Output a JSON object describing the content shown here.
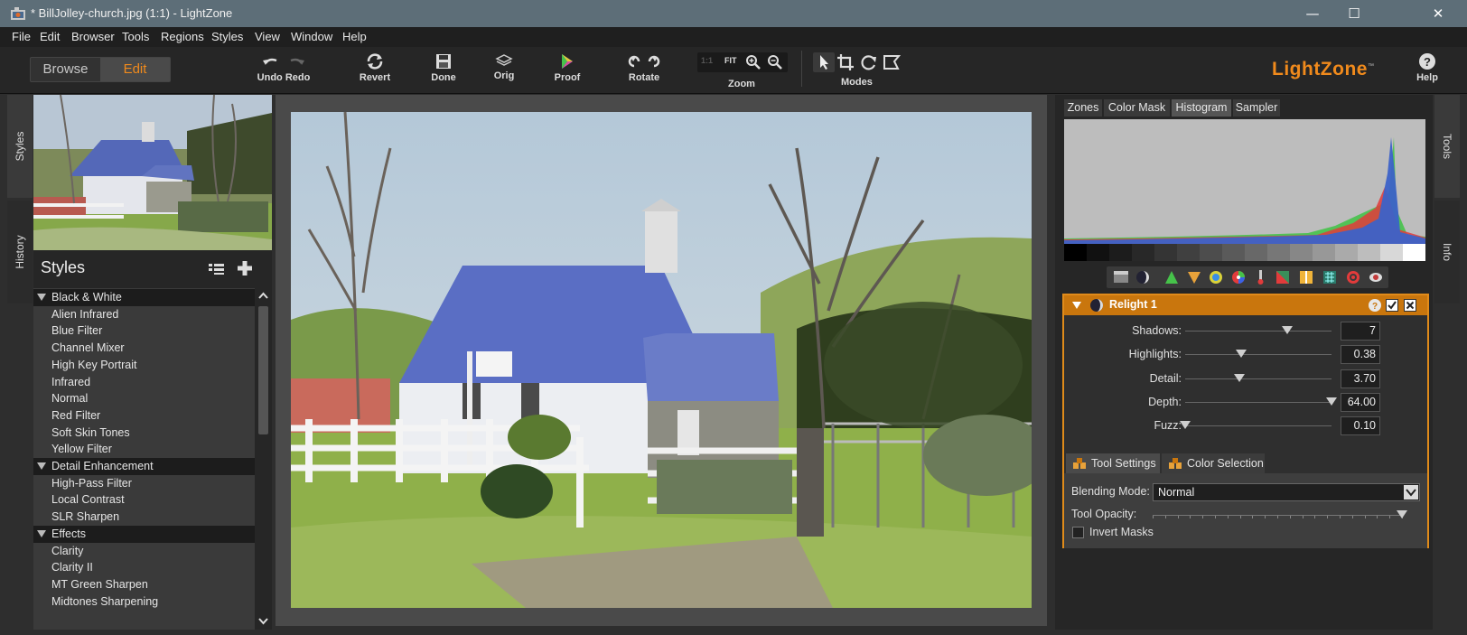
{
  "window": {
    "title": "* BillJolley-church.jpg (1:1) - LightZone",
    "minimize": "—",
    "maximize": "☐",
    "close": "✕"
  },
  "menu": [
    "File",
    "Edit",
    "Browser",
    "Tools",
    "Regions",
    "Styles",
    "View",
    "Window",
    "Help"
  ],
  "toolbar": {
    "browse": "Browse",
    "edit": "Edit",
    "undo_redo": "Undo Redo",
    "revert": "Revert",
    "done": "Done",
    "orig": "Orig",
    "proof": "Proof",
    "rotate": "Rotate",
    "zoom": "Zoom",
    "zoom_11": "1:1",
    "zoom_fit": "FIT",
    "modes": "Modes",
    "help": "Help",
    "logo": "LightZone",
    "logo_tm": "™"
  },
  "side_tabs": {
    "styles": "Styles",
    "history": "History",
    "tools": "Tools",
    "info": "Info"
  },
  "styles_panel": {
    "title": "Styles",
    "items": [
      {
        "label": "Black & White",
        "type": "cat"
      },
      {
        "label": "Alien Infrared",
        "type": "item"
      },
      {
        "label": "Blue Filter",
        "type": "item"
      },
      {
        "label": "Channel Mixer",
        "type": "item"
      },
      {
        "label": "High Key Portrait",
        "type": "item"
      },
      {
        "label": "Infrared",
        "type": "item"
      },
      {
        "label": "Normal",
        "type": "item"
      },
      {
        "label": "Red Filter",
        "type": "item"
      },
      {
        "label": "Soft Skin Tones",
        "type": "item"
      },
      {
        "label": "Yellow Filter",
        "type": "item"
      },
      {
        "label": "Detail Enhancement",
        "type": "cat"
      },
      {
        "label": "High-Pass Filter",
        "type": "item"
      },
      {
        "label": "Local Contrast",
        "type": "item"
      },
      {
        "label": "SLR Sharpen",
        "type": "item"
      },
      {
        "label": "Effects",
        "type": "cat"
      },
      {
        "label": "Clarity",
        "type": "item"
      },
      {
        "label": "Clarity II",
        "type": "item"
      },
      {
        "label": "MT Green Sharpen",
        "type": "item"
      },
      {
        "label": "Midtones Sharpening",
        "type": "item"
      }
    ]
  },
  "right_tabs": [
    "Zones",
    "Color Mask",
    "Histogram",
    "Sampler"
  ],
  "right_tab_active": "Histogram",
  "relight": {
    "title": "Relight 1",
    "sliders": [
      {
        "label": "Shadows:",
        "value": "7",
        "level": 0.7
      },
      {
        "label": "Highlights:",
        "value": "0.38",
        "level": 0.38
      },
      {
        "label": "Detail:",
        "value": "3.70",
        "level": 0.37
      },
      {
        "label": "Depth:",
        "value": "64.00",
        "level": 1.0
      },
      {
        "label": "Fuzz:",
        "value": "0.10",
        "level": 0.0
      }
    ],
    "tab_tool_settings": "Tool Settings",
    "tab_color_selection": "Color Selection",
    "blending_mode_label": "Blending Mode:",
    "blending_mode_value": "Normal",
    "tool_opacity_label": "Tool Opacity:",
    "tool_opacity_level": 1.0,
    "invert_masks_label": "Invert Masks"
  },
  "colors": {
    "accent": "#f08a1c",
    "panel_header": "#c9760d"
  }
}
